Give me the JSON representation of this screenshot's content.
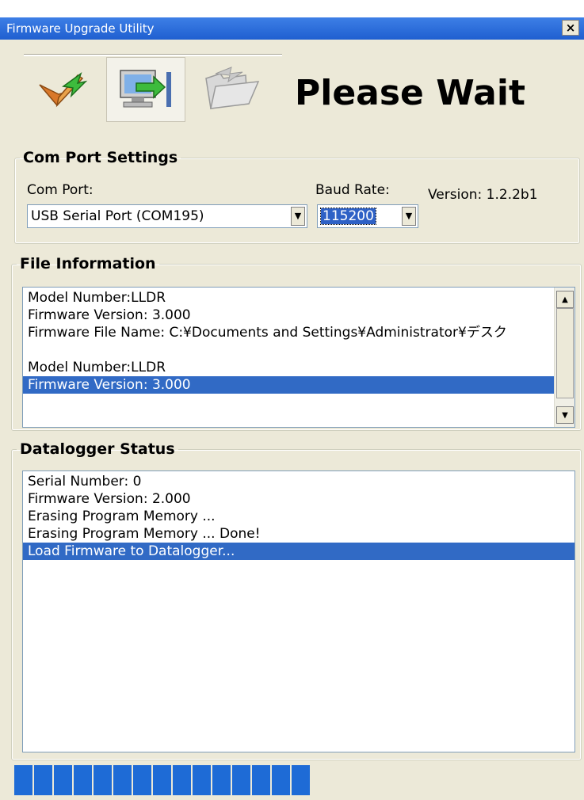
{
  "window": {
    "title": "Firmware Upgrade Utility",
    "close_label": "×"
  },
  "header": {
    "status_title": "Please Wait",
    "steps": [
      {
        "icon": "check-arrow-icon"
      },
      {
        "icon": "computer-transfer-icon"
      },
      {
        "icon": "folder-arrow-icon"
      }
    ]
  },
  "com_port_settings": {
    "group_title": "Com Port Settings",
    "com_port_label": "Com Port:",
    "com_port_value": "USB Serial Port (COM195)",
    "baud_rate_label": "Baud Rate:",
    "baud_rate_value": "115200",
    "version_text": "Version: 1.2.2b1"
  },
  "file_information": {
    "group_title": "File Information",
    "lines": [
      "Model Number:LLDR",
      "Firmware Version: 3.000",
      "Firmware File Name: C:¥Documents and Settings¥Administrator¥デスク",
      "",
      "Model Number:LLDR",
      "Firmware Version: 3.000"
    ],
    "selected_index": 5
  },
  "datalogger_status": {
    "group_title": "Datalogger Status",
    "lines": [
      "Serial Number: 0",
      "Firmware Version: 2.000",
      "Erasing Program Memory ...",
      "Erasing Program Memory ... Done!",
      "Load Firmware to Datalogger..."
    ],
    "selected_index": 4
  },
  "progress": {
    "filled_fraction": 0.545,
    "color": "#1e6bd6"
  },
  "colors": {
    "titlebar": "#3d7fe6",
    "selection": "#316ac5",
    "window_bg": "#ece9d8"
  }
}
